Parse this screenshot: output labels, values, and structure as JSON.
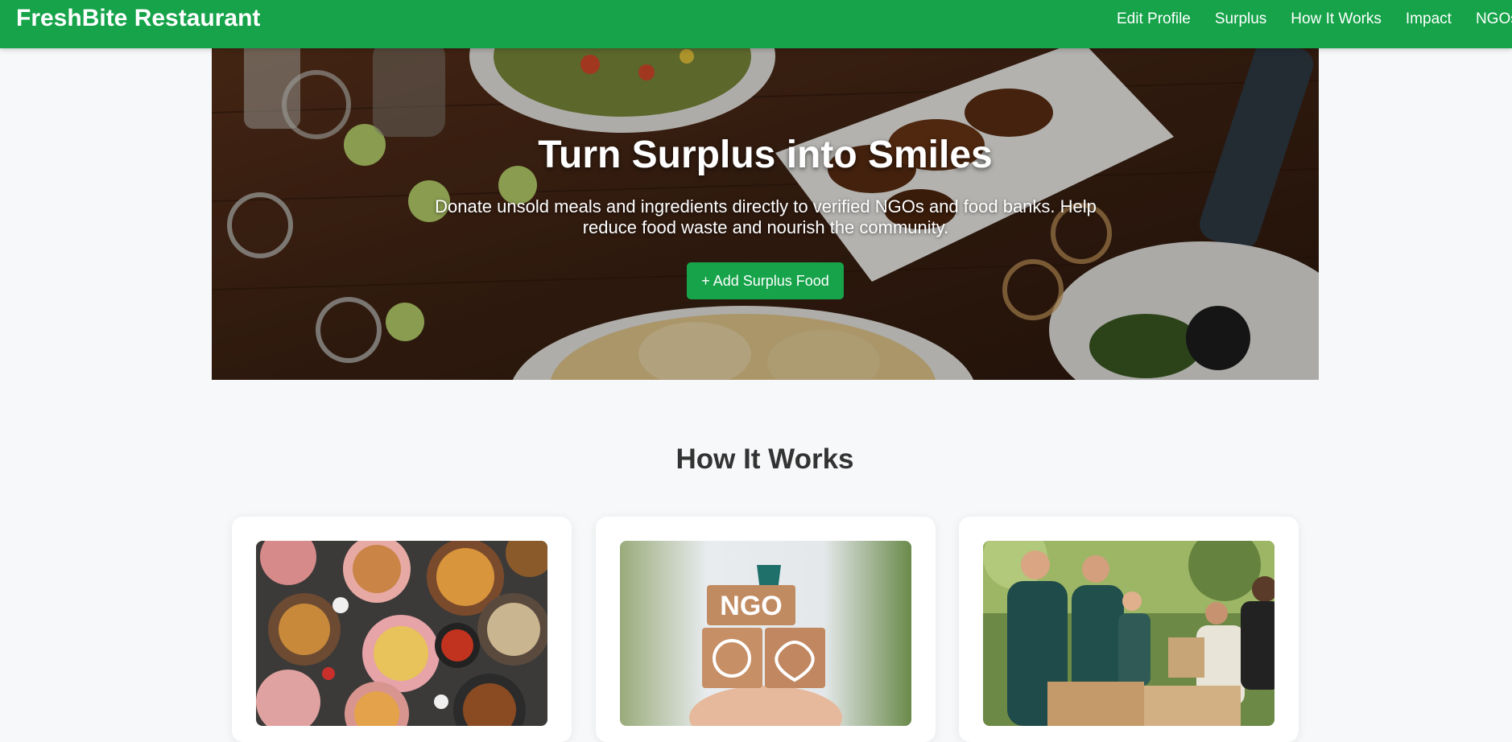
{
  "navbar": {
    "brand": "FreshBite Restaurant",
    "links": [
      "Edit Profile",
      "Surplus",
      "How It Works",
      "Impact",
      "NGOs"
    ]
  },
  "hero": {
    "title": "Turn Surplus into Smiles",
    "subtitle": "Donate unsold meals and ingredients directly to verified NGOs and food banks. Help reduce food waste and nourish the community.",
    "button_label": "+ Add Surplus Food"
  },
  "how_it_works": {
    "title": "How It Works",
    "cards": [
      {
        "image": "food-dishes-photo"
      },
      {
        "image": "ngo-blocks-photo",
        "badge": "NGO"
      },
      {
        "image": "volunteers-photo"
      }
    ]
  },
  "colors": {
    "brand_green": "#16a34a",
    "page_bg": "#f6f8f9",
    "heading_text": "#333333"
  }
}
